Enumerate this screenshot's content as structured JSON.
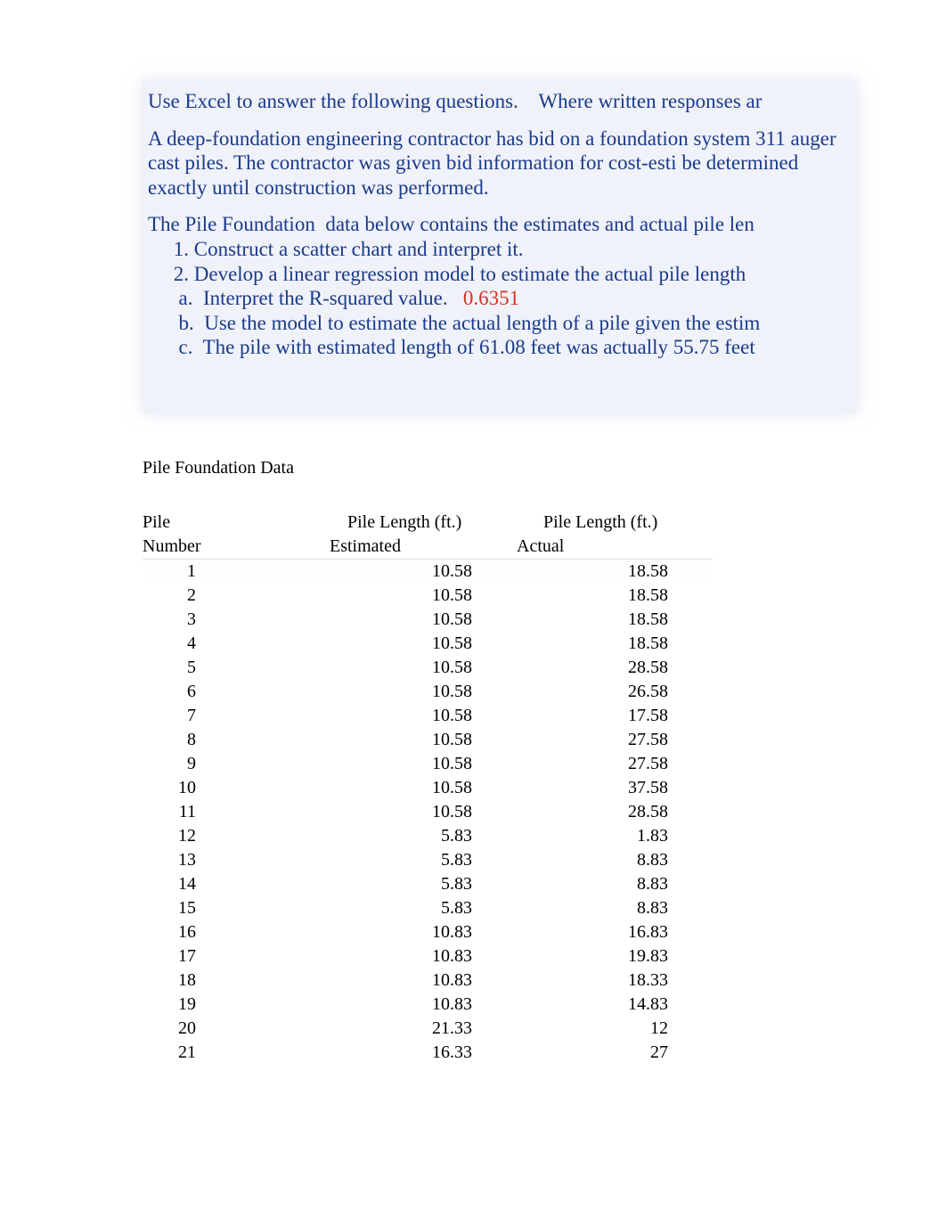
{
  "instructions": {
    "intro": "Use Excel to answer the following questions.    Where written responses ar",
    "para": "A deep-foundation engineering contractor has bid on a foundation system 311 auger cast piles. The contractor was given bid information for cost-esti be determined exactly until construction was performed.",
    "lead": "The Pile Foundation  data below contains the estimates and actual pile len",
    "items": {
      "i1": "     1. Construct a scatter chart and interpret it.",
      "i2": "     2. Develop a linear regression model to estimate the actual pile length",
      "ia_pre": "      a.  Interpret the R-squared value.   ",
      "ia_val": "0.6351",
      "ib": "      b.  Use the model to estimate the actual length of a pile given the estim",
      "ic": "      c.  The pile with estimated length of 61.08 feet was actually 55.75 feet"
    }
  },
  "table": {
    "title": "Pile Foundation Data",
    "head": {
      "c1a": "Pile",
      "c1b": "Number",
      "c2a": "Pile Length (ft.)",
      "c2b": "Estimated",
      "c3a": "Pile Length (ft.)",
      "c3b": "Actual"
    },
    "rows": [
      {
        "n": "1",
        "e": "10.58",
        "a": "18.58"
      },
      {
        "n": "2",
        "e": "10.58",
        "a": "18.58"
      },
      {
        "n": "3",
        "e": "10.58",
        "a": "18.58"
      },
      {
        "n": "4",
        "e": "10.58",
        "a": "18.58"
      },
      {
        "n": "5",
        "e": "10.58",
        "a": "28.58"
      },
      {
        "n": "6",
        "e": "10.58",
        "a": "26.58"
      },
      {
        "n": "7",
        "e": "10.58",
        "a": "17.58"
      },
      {
        "n": "8",
        "e": "10.58",
        "a": "27.58"
      },
      {
        "n": "9",
        "e": "10.58",
        "a": "27.58"
      },
      {
        "n": "10",
        "e": "10.58",
        "a": "37.58"
      },
      {
        "n": "11",
        "e": "10.58",
        "a": "28.58"
      },
      {
        "n": "12",
        "e": "5.83",
        "a": "1.83"
      },
      {
        "n": "13",
        "e": "5.83",
        "a": "8.83"
      },
      {
        "n": "14",
        "e": "5.83",
        "a": "8.83"
      },
      {
        "n": "15",
        "e": "5.83",
        "a": "8.83"
      },
      {
        "n": "16",
        "e": "10.83",
        "a": "16.83"
      },
      {
        "n": "17",
        "e": "10.83",
        "a": "19.83"
      },
      {
        "n": "18",
        "e": "10.83",
        "a": "18.33"
      },
      {
        "n": "19",
        "e": "10.83",
        "a": "14.83"
      },
      {
        "n": "20",
        "e": "21.33",
        "a": "12"
      },
      {
        "n": "21",
        "e": "16.33",
        "a": "27"
      }
    ]
  }
}
